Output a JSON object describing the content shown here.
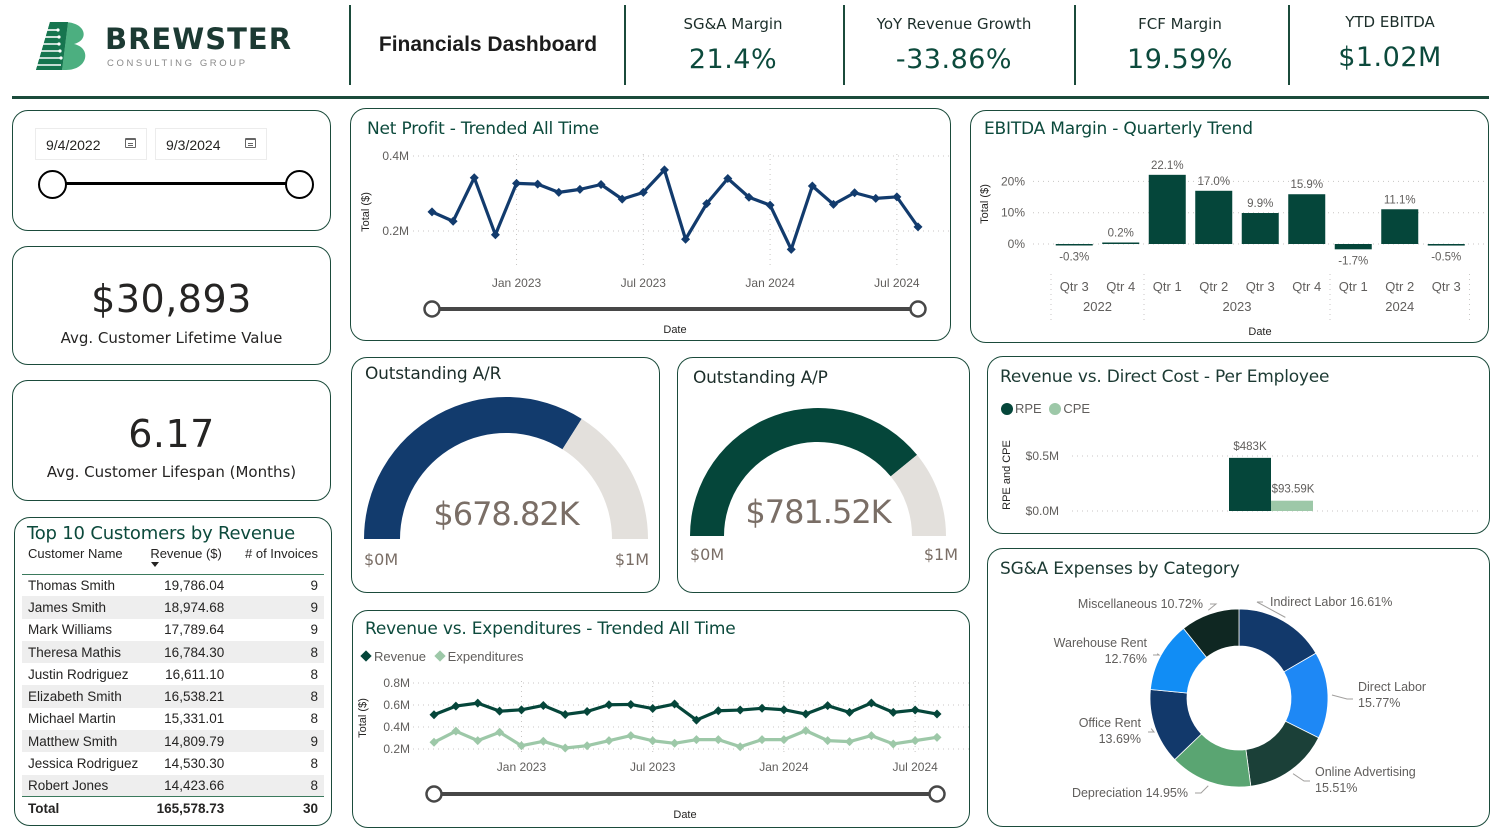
{
  "header": {
    "brand_name": "BREWSTER",
    "brand_sub": "CONSULTING GROUP",
    "title": "Financials Dashboard",
    "colors": {
      "brand": "#0c4a3c",
      "logo_light": "#4caf80",
      "logo_dark": "#1a7a55"
    },
    "kpis": [
      {
        "label": "SG&A Margin",
        "value": "21.4%"
      },
      {
        "label": "YoY Revenue Growth",
        "value": "-33.86%"
      },
      {
        "label": "FCF Margin",
        "value": "19.59%"
      },
      {
        "label": "YTD EBITDA",
        "value": "$1.02M"
      }
    ]
  },
  "date_slicer": {
    "start": "9/4/2022",
    "end": "9/3/2024",
    "range_fraction": [
      0,
      1
    ]
  },
  "cards": {
    "clv": {
      "value": "$30,893",
      "label": "Avg. Customer Lifetime Value"
    },
    "lifespan": {
      "value": "6.17",
      "label": "Avg. Customer Lifespan (Months)"
    }
  },
  "top_customers": {
    "title": "Top 10 Customers by Revenue",
    "columns": [
      "Customer Name",
      "Revenue ($)",
      "# of Invoices"
    ],
    "sort_column": "Revenue ($)",
    "rows": [
      {
        "name": "Thomas Smith",
        "revenue": "19,786.04",
        "invoices": "9"
      },
      {
        "name": "James Smith",
        "revenue": "18,974.68",
        "invoices": "9"
      },
      {
        "name": "Mark Williams",
        "revenue": "17,789.64",
        "invoices": "9"
      },
      {
        "name": "Theresa Mathis",
        "revenue": "16,784.30",
        "invoices": "8"
      },
      {
        "name": "Justin Rodriguez",
        "revenue": "16,611.10",
        "invoices": "8"
      },
      {
        "name": "Elizabeth Smith",
        "revenue": "16,538.21",
        "invoices": "8"
      },
      {
        "name": "Michael Martin",
        "revenue": "15,331.01",
        "invoices": "8"
      },
      {
        "name": "Matthew Smith",
        "revenue": "14,809.79",
        "invoices": "9"
      },
      {
        "name": "Jessica Rodriguez",
        "revenue": "14,530.30",
        "invoices": "8"
      },
      {
        "name": "Robert Jones",
        "revenue": "14,423.66",
        "invoices": "8"
      }
    ],
    "total": {
      "label": "Total",
      "revenue": "165,578.73",
      "invoices": "30"
    }
  },
  "gauges": {
    "ar": {
      "title": "Outstanding A/R",
      "value": 678.82,
      "display": "$678.82K",
      "min_label": "$0M",
      "max_label": "$1M",
      "max": 1000,
      "color": "#123b6d",
      "track": "#e3e0dc"
    },
    "ap": {
      "title": "Outstanding A/P",
      "value": 781.52,
      "display": "$781.52K",
      "min_label": "$0M",
      "max_label": "$1M",
      "max": 1000,
      "color": "#05463a",
      "track": "#e3e0dc"
    }
  },
  "chart_data": [
    {
      "id": "net-profit",
      "type": "line",
      "title": "Net Profit - Trended All Time",
      "xlabel": "Date",
      "ylabel": "Total ($)",
      "x": [
        "Sep 2022",
        "Oct 2022",
        "Nov 2022",
        "Dec 2022",
        "Jan 2023",
        "Feb 2023",
        "Mar 2023",
        "Apr 2023",
        "May 2023",
        "Jun 2023",
        "Jul 2023",
        "Aug 2023",
        "Sep 2023",
        "Oct 2023",
        "Nov 2023",
        "Dec 2023",
        "Jan 2024",
        "Feb 2024",
        "Mar 2024",
        "Apr 2024",
        "May 2024",
        "Jun 2024",
        "Jul 2024",
        "Aug 2024"
      ],
      "x_ticks": [
        "Jan 2023",
        "Jul 2023",
        "Jan 2024",
        "Jul 2024"
      ],
      "x_tick_index": [
        4,
        10,
        16,
        22
      ],
      "y_ticks": [
        0.2,
        0.4
      ],
      "y_tick_labels": [
        "0.2M",
        "0.4M"
      ],
      "ylim": [
        0.15,
        0.4
      ],
      "series": [
        {
          "name": "Net Profit",
          "color": "#123b6d",
          "values": [
            0.251,
            0.226,
            0.342,
            0.19,
            0.327,
            0.325,
            0.303,
            0.311,
            0.324,
            0.285,
            0.303,
            0.363,
            0.178,
            0.273,
            0.34,
            0.29,
            0.269,
            0.151,
            0.32,
            0.271,
            0.302,
            0.287,
            0.291,
            0.211
          ]
        }
      ],
      "units": "M$",
      "grid": true
    },
    {
      "id": "ebitda",
      "type": "bar",
      "title": "EBITDA Margin - Quarterly Trend",
      "xlabel": "Date",
      "ylabel": "Total ($)",
      "categories": [
        "Qtr 3",
        "Qtr 4",
        "Qtr 1",
        "Qtr 2",
        "Qtr 3",
        "Qtr 4",
        "Qtr 1",
        "Qtr 2",
        "Qtr 3"
      ],
      "groups": [
        {
          "label": "2022",
          "count": 2
        },
        {
          "label": "2023",
          "count": 4
        },
        {
          "label": "2024",
          "count": 3
        }
      ],
      "values": [
        -0.3,
        0.2,
        22.1,
        17.0,
        9.9,
        15.9,
        -1.7,
        11.1,
        -0.5
      ],
      "data_labels": [
        "-0.3%",
        "0.2%",
        "22.1%",
        "17.0%",
        "9.9%",
        "15.9%",
        "-1.7%",
        "11.1%",
        "-0.5%"
      ],
      "y_ticks": [
        0,
        10,
        20
      ],
      "y_tick_labels": [
        "0%",
        "10%",
        "20%"
      ],
      "ylim": [
        -3,
        23
      ],
      "color": "#05463a",
      "grid": true
    },
    {
      "id": "rpe-cpe",
      "type": "bar",
      "title": "Revenue vs. Direct Cost - Per Employee",
      "ylabel": "RPE and CPE",
      "legend": "top-left",
      "series": [
        {
          "name": "RPE",
          "value": 483,
          "label": "$483K",
          "color": "#05463a"
        },
        {
          "name": "CPE",
          "value": 93.59,
          "label": "$93.59K",
          "color": "#9dc8a8"
        }
      ],
      "y_ticks": [
        0,
        500
      ],
      "y_tick_labels": [
        "$0.0M",
        "$0.5M"
      ],
      "ylim": [
        0,
        500
      ],
      "units": "K$",
      "grid": true
    },
    {
      "id": "rev-exp",
      "type": "line",
      "title": "Revenue vs. Expenditures - Trended All Time",
      "xlabel": "Date",
      "ylabel": "Total ($)",
      "legend": "top-left",
      "x": [
        "Sep 2022",
        "Oct 2022",
        "Nov 2022",
        "Dec 2022",
        "Jan 2023",
        "Feb 2023",
        "Mar 2023",
        "Apr 2023",
        "May 2023",
        "Jun 2023",
        "Jul 2023",
        "Aug 2023",
        "Sep 2023",
        "Oct 2023",
        "Nov 2023",
        "Dec 2023",
        "Jan 2024",
        "Feb 2024",
        "Mar 2024",
        "Apr 2024",
        "May 2024",
        "Jun 2024",
        "Jul 2024",
        "Aug 2024"
      ],
      "x_ticks": [
        "Jan 2023",
        "Jul 2023",
        "Jan 2024",
        "Jul 2024"
      ],
      "x_tick_index": [
        4,
        10,
        16,
        22
      ],
      "y_ticks": [
        0.2,
        0.4,
        0.6,
        0.8
      ],
      "y_tick_labels": [
        "0.2M",
        "0.4M",
        "0.6M",
        "0.8M"
      ],
      "ylim": [
        0.2,
        0.8
      ],
      "series": [
        {
          "name": "Revenue",
          "color": "#05463a",
          "values": [
            0.511,
            0.59,
            0.617,
            0.544,
            0.556,
            0.596,
            0.514,
            0.541,
            0.602,
            0.605,
            0.568,
            0.609,
            0.463,
            0.548,
            0.554,
            0.57,
            0.557,
            0.518,
            0.594,
            0.533,
            0.618,
            0.533,
            0.554,
            0.518
          ]
        },
        {
          "name": "Expenditures",
          "color": "#9dc8a8",
          "values": [
            0.261,
            0.362,
            0.276,
            0.352,
            0.23,
            0.27,
            0.209,
            0.23,
            0.276,
            0.322,
            0.275,
            0.252,
            0.285,
            0.285,
            0.221,
            0.285,
            0.285,
            0.367,
            0.276,
            0.267,
            0.322,
            0.246,
            0.276,
            0.306
          ]
        }
      ],
      "units": "M$",
      "grid": true
    },
    {
      "id": "sga",
      "type": "pie",
      "title": "SG&A Expenses by Category",
      "donut": true,
      "slices": [
        {
          "name": "Indirect Labor",
          "value": 16.61,
          "label": "16.61%",
          "color": "#12396b"
        },
        {
          "name": "Direct Labor",
          "value": 15.77,
          "label": "15.77%",
          "color": "#1e88f5"
        },
        {
          "name": "Online Advertising",
          "value": 15.51,
          "label": "15.51%",
          "color": "#1b4038"
        },
        {
          "name": "Depreciation",
          "value": 14.95,
          "label": "14.95%",
          "color": "#5aa572"
        },
        {
          "name": "Office Rent",
          "value": 13.69,
          "label": "13.69%",
          "color": "#12396b"
        },
        {
          "name": "Warehouse Rent",
          "value": 12.76,
          "label": "12.76%",
          "color": "#118df5"
        },
        {
          "name": "Miscellaneous",
          "value": 10.72,
          "label": "10.72%",
          "color": "#0f2722"
        }
      ]
    }
  ]
}
